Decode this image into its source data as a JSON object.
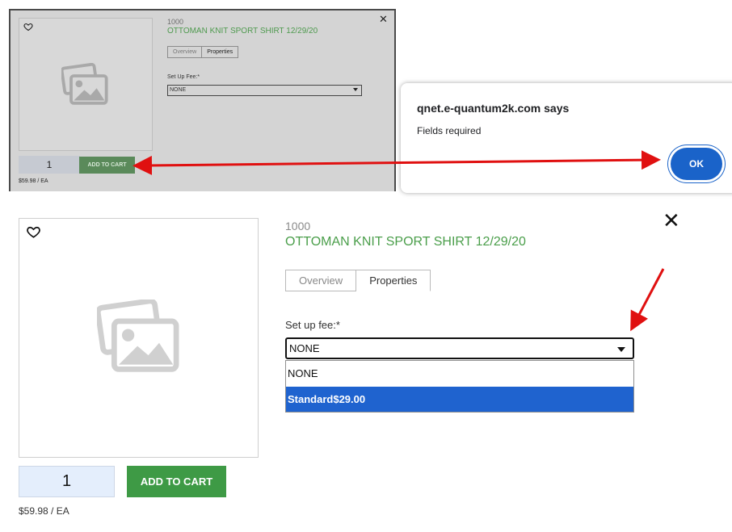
{
  "top_modal": {
    "sku": "1000",
    "product_name": "OTTOMAN KNIT SPORT SHIRT 12/29/20",
    "tabs": [
      {
        "label": "Overview",
        "active": false
      },
      {
        "label": "Properties",
        "active": true
      }
    ],
    "setup_fee_label": "Set Up Fee:*",
    "setup_fee_value": "NONE",
    "quantity": "1",
    "add_to_cart_label": "ADD TO CART",
    "price": "$59.98 / EA",
    "close_glyph": "✕"
  },
  "alert": {
    "title": "qnet.e-quantum2k.com says",
    "message": "Fields required",
    "ok_label": "OK",
    "accent_color": "#1a63c9"
  },
  "bottom_modal": {
    "sku": "1000",
    "product_name": "OTTOMAN KNIT SPORT SHIRT 12/29/20",
    "tabs": [
      {
        "label": "Overview",
        "active": false
      },
      {
        "label": "Properties",
        "active": true
      }
    ],
    "setup_fee_label": "Set up fee:*",
    "setup_fee_value": "NONE",
    "dropdown_options": [
      {
        "label": "NONE",
        "highlighted": false
      },
      {
        "label": "Standard$29.00",
        "highlighted": true
      }
    ],
    "quantity": "1",
    "add_to_cart_label": "ADD TO CART",
    "price": "$59.98 / EA",
    "close_glyph": "✕",
    "brand_green": "#3e9a45",
    "highlight_blue": "#1f63cf"
  },
  "annotations": {
    "arrow_color": "#e01010"
  }
}
